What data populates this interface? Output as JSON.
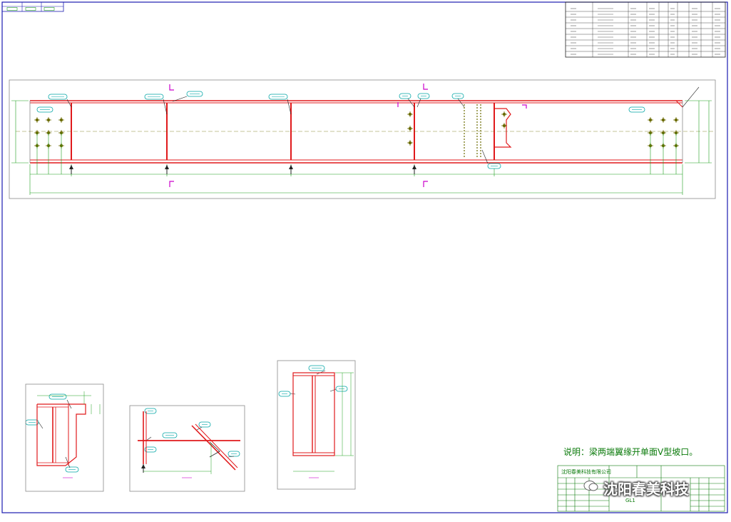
{
  "drawing": {
    "note": "说明：梁两端翼缘开单面V型坡口。",
    "watermark": "沈阳春美科技",
    "title_block": {
      "company": "沈阳春美科技有限公司",
      "drawing_name": "GL1"
    },
    "colors": {
      "frame": "#1b1bb0",
      "member": "#e0191b",
      "dimension": "#1fa01f",
      "label_border": "#00a5a5",
      "section_mark": "#cc00cc",
      "bolt": "#6b6b00",
      "note": "#0a7a0a"
    }
  }
}
